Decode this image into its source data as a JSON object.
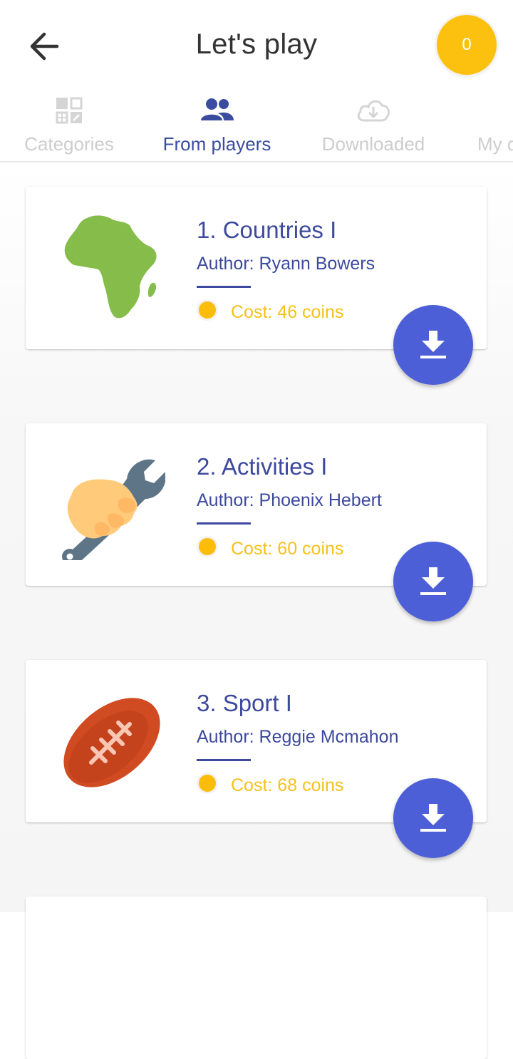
{
  "header": {
    "title": "Let's play",
    "coins": "0"
  },
  "tabs": [
    {
      "label": "Categories",
      "icon": "categories-grid-icon",
      "active": false
    },
    {
      "label": "From players",
      "icon": "people-icon",
      "active": true
    },
    {
      "label": "Downloaded",
      "icon": "cloud-download-icon",
      "active": false
    },
    {
      "label": "My q",
      "icon": "",
      "active": false
    }
  ],
  "quizzes": [
    {
      "title": "1. Countries I",
      "author": "Author: Ryann Bowers",
      "cost": "Cost: 46 coins",
      "image": "africa-map"
    },
    {
      "title": "2. Activities I",
      "author": "Author: Phoenix Hebert",
      "cost": "Cost: 60 coins",
      "image": "hand-wrench"
    },
    {
      "title": "3. Sport I",
      "author": "Author: Reggie Mcmahon",
      "cost": "Cost: 68 coins",
      "image": "american-football"
    }
  ],
  "colors": {
    "accent": "#4c5fd7",
    "title_text": "#3d4a9e",
    "coin": "#fbbd0a",
    "tab_indicator": "#16907c"
  }
}
